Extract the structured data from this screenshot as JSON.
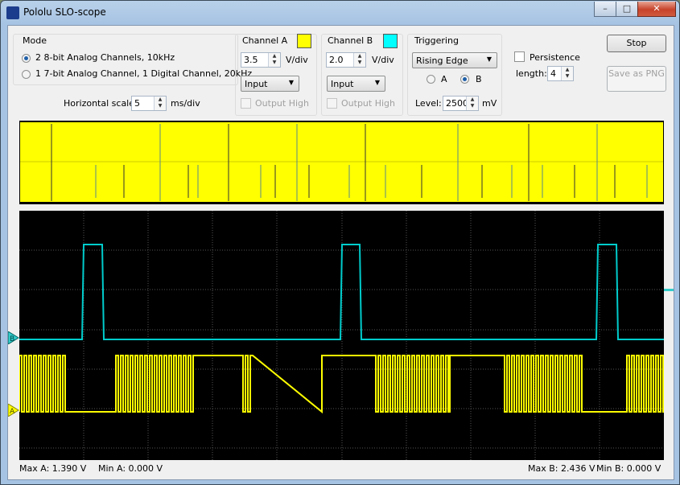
{
  "window": {
    "title": "Pololu SLO-scope",
    "controls": [
      "–",
      "□",
      "✕"
    ]
  },
  "mode": {
    "title": "Mode",
    "options": [
      "2 8-bit Analog Channels, 10kHz",
      "1 7-bit Analog Channel, 1 Digital Channel, 20kHz"
    ],
    "selected": 0
  },
  "horizontal": {
    "label": "Horizontal scale:",
    "value": "5",
    "unit": "ms/div"
  },
  "channel_a": {
    "title": "Channel A",
    "color": "#ffff00",
    "volts": "3.5",
    "unit": "V/div",
    "coupling": "Input",
    "output_high": "Output High"
  },
  "channel_b": {
    "title": "Channel B",
    "color": "#00ffff",
    "volts": "2.0",
    "unit": "V/div",
    "coupling": "Input",
    "output_high": "Output High"
  },
  "triggering": {
    "title": "Triggering",
    "edge": "Rising Edge",
    "source_a": "A",
    "source_b": "B",
    "selected": "B",
    "level_label": "Level:",
    "level": "2500",
    "level_unit": "mV"
  },
  "persistence": {
    "label": "Persistence",
    "length_label": "length:",
    "length": "4"
  },
  "buttons": {
    "stop": "Stop",
    "save": "Save as PNG"
  },
  "status": {
    "max_a": "Max A: 1.390 V",
    "min_a": "Min A: 0.000 V",
    "max_b": "Max B: 2.436 V",
    "min_b": "Min B: 0.000 V"
  },
  "markers": {
    "a": "A",
    "b": "B"
  },
  "trace_colors": {
    "a": "#ffff00",
    "b": "#00cccc",
    "grid": "#505050",
    "background": "#000000"
  }
}
